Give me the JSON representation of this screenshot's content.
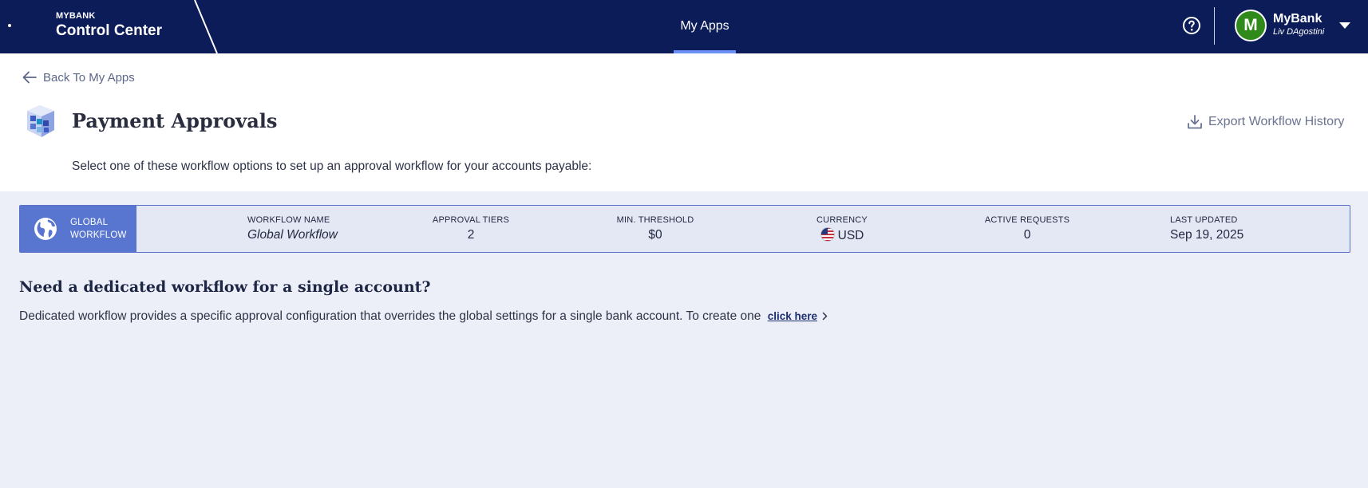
{
  "topbar": {
    "brand_small": "MYBANK",
    "brand_big": "Control Center",
    "nav_tab": "My Apps",
    "account_name": "MyBank",
    "account_user": "Liv DAgostini",
    "avatar_initial": "M",
    "colors": {
      "bar": "#0b1c59",
      "active_tab": "#6c8ff5",
      "avatar": "#2f8a1b"
    }
  },
  "header": {
    "back_label": "Back To My Apps",
    "title": "Payment Approvals",
    "export_label": "Export Workflow History",
    "instructions": "Select one of these workflow options to set up an approval workflow for your accounts payable:"
  },
  "workflow": {
    "badge_line1": "GLOBAL",
    "badge_line2": "WORKFLOW",
    "columns": [
      {
        "header": "WORKFLOW NAME",
        "value": "Global Workflow"
      },
      {
        "header": "APPROVAL TIERS",
        "value": "2"
      },
      {
        "header": "MIN. THRESHOLD",
        "value": "$0"
      },
      {
        "header": "CURRENCY",
        "value": "USD"
      },
      {
        "header": "ACTIVE REQUESTS",
        "value": "0"
      },
      {
        "header": "LAST UPDATED",
        "value": "Sep 19, 2025"
      }
    ],
    "icons": {
      "badge": "globe-icon",
      "currency": "us-flag-icon"
    },
    "colors": {
      "badge": "#5876d0",
      "border": "#5a72c9"
    }
  },
  "dedicated": {
    "title": "Need a dedicated workflow for a single account?",
    "text": "Dedicated workflow provides a specific approval configuration that overrides the global settings for a single bank account. To create one",
    "link": "click here"
  }
}
